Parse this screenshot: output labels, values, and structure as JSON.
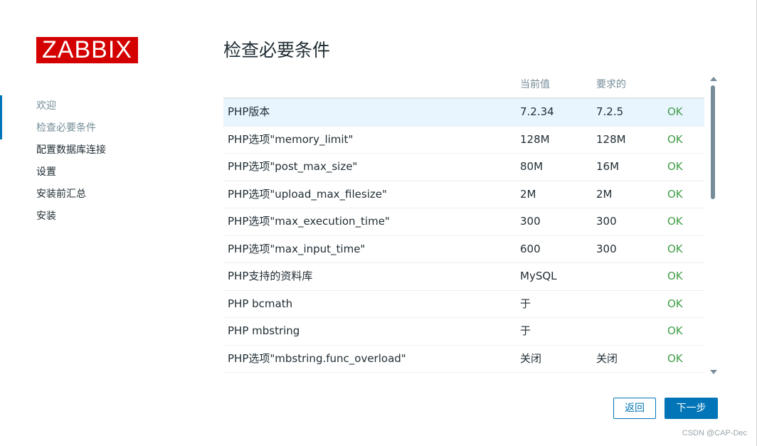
{
  "logo": {
    "text": "ZABBIX"
  },
  "sidebar": {
    "items": [
      {
        "label": "欢迎"
      },
      {
        "label": "检查必要条件"
      },
      {
        "label": "配置数据库连接"
      },
      {
        "label": "设置"
      },
      {
        "label": "安装前汇总"
      },
      {
        "label": "安装"
      }
    ]
  },
  "main": {
    "title": "检查必要条件",
    "table": {
      "headers": [
        "",
        "当前值",
        "要求的",
        ""
      ],
      "rows": [
        {
          "name": "PHP版本",
          "current": "7.2.34",
          "required": "7.2.5",
          "status": "OK"
        },
        {
          "name": "PHP选项\"memory_limit\"",
          "current": "128M",
          "required": "128M",
          "status": "OK"
        },
        {
          "name": "PHP选项\"post_max_size\"",
          "current": "80M",
          "required": "16M",
          "status": "OK"
        },
        {
          "name": "PHP选项\"upload_max_filesize\"",
          "current": "2M",
          "required": "2M",
          "status": "OK"
        },
        {
          "name": "PHP选项\"max_execution_time\"",
          "current": "300",
          "required": "300",
          "status": "OK"
        },
        {
          "name": "PHP选项\"max_input_time\"",
          "current": "600",
          "required": "300",
          "status": "OK"
        },
        {
          "name": "PHP支持的资料库",
          "current": "MySQL",
          "required": "",
          "status": "OK"
        },
        {
          "name": "PHP bcmath",
          "current": "于",
          "required": "",
          "status": "OK"
        },
        {
          "name": "PHP mbstring",
          "current": "于",
          "required": "",
          "status": "OK"
        },
        {
          "name": "PHP选项\"mbstring.func_overload\"",
          "current": "关闭",
          "required": "关闭",
          "status": "OK"
        },
        {
          "name": "",
          "current": "",
          "required": "",
          "status": ""
        }
      ]
    }
  },
  "buttons": {
    "back": "返回",
    "next": "下一步"
  },
  "watermark": "CSDN @CAP-Dec",
  "colors": {
    "brand": "#d40000",
    "accent": "#0275b8",
    "ok": "#429e47",
    "highlight_row": "#e8f5ff"
  }
}
